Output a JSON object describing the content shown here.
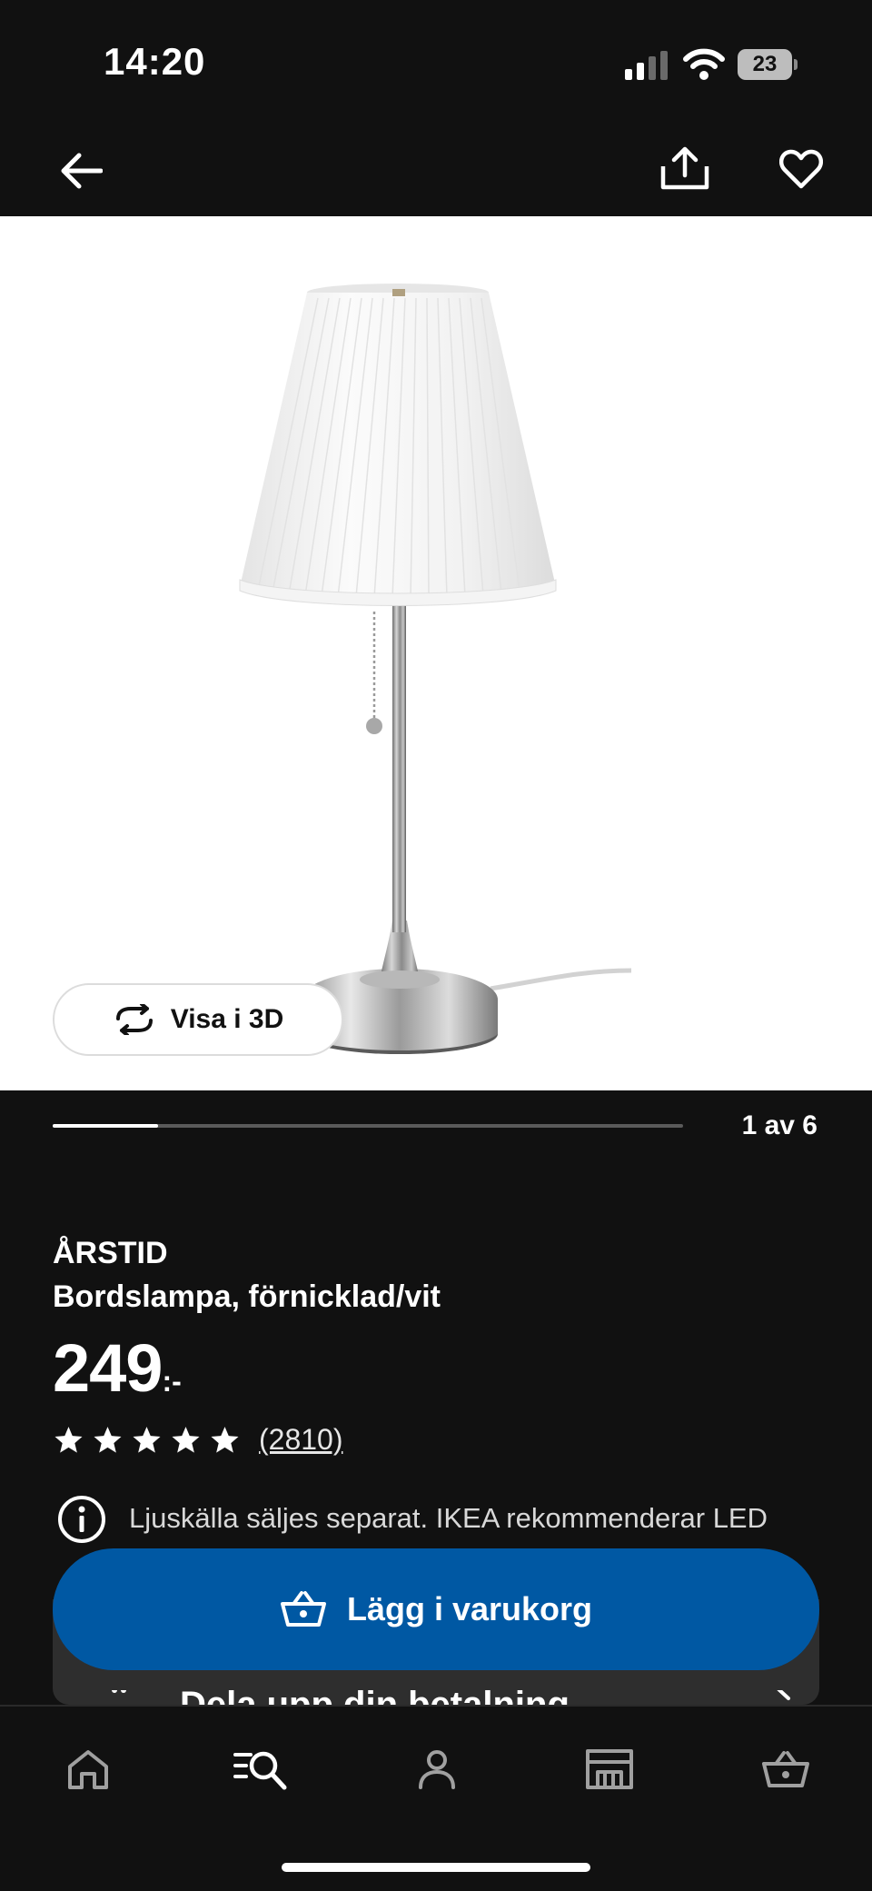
{
  "status_bar": {
    "time": "14:20",
    "battery": "23"
  },
  "nav": {
    "back_icon": "arrow-left-icon",
    "share_icon": "share-icon",
    "favorite_icon": "heart-icon"
  },
  "gallery": {
    "view3d_label": "Visa i 3D",
    "counter": "1 av 6",
    "current": 1,
    "total": 6
  },
  "product": {
    "brand": "ÅRSTID",
    "description": "Bordslampa, förnicklad/vit",
    "price": "249",
    "price_suffix": ":-",
    "rating": 5,
    "review_count": "(2810)",
    "info_text": "Ljuskälla säljes separat. IKEA rekommenderar LED",
    "partial_row_text": "Dela upp din betalning"
  },
  "actions": {
    "add_to_cart_label": "Lägg i varukorg"
  },
  "tab_bar": {
    "items": [
      {
        "icon": "home-icon"
      },
      {
        "icon": "search-list-icon"
      },
      {
        "icon": "profile-icon"
      },
      {
        "icon": "store-icon"
      },
      {
        "icon": "cart-icon"
      }
    ]
  },
  "colors": {
    "background": "#111111",
    "accent": "#0058a3"
  }
}
